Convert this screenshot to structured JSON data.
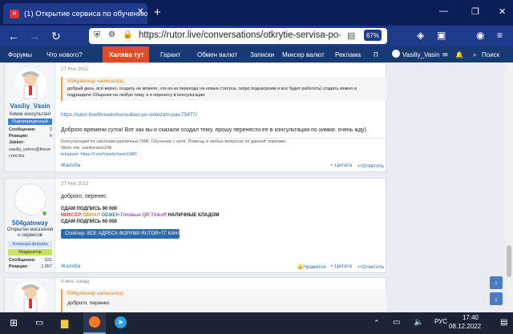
{
  "browser": {
    "tab_title": "(1) Открытие сервиса по обучению",
    "url": "https://rutor.live/conversations/otkrytie-servisa-po-obuchen",
    "zoom": "67%"
  },
  "site_menu": {
    "items": [
      "Форумы",
      "Что нового?",
      "Халява тут",
      "Гарант",
      "Обмен валют",
      "Записки",
      "Миксер валют",
      "Реклама",
      "П"
    ],
    "user": "Vasiliy_Vasin",
    "search": "Поиск"
  },
  "posts": [
    {
      "username": "Vasiliy_Vasin",
      "user_title": "Химик консультант",
      "badge": "Подтвержденный",
      "stats": [
        {
          "label": "Сообщения:",
          "value": "2"
        },
        {
          "label": "Реакции:",
          "value": "6"
        },
        {
          "label": "Jabber:",
          "value": ""
        }
      ],
      "jabber_value": "vasiliy_vetrov@thesecure.biz",
      "date": "27 Ноя 2022",
      "quote_author": "504gateway написал(а):",
      "quote_lines": [
        "добрый день, все верно, создать не можете, это из-за перехода на новые статусы, скоро поднасроим и все будет работать) создать можно в",
        "подразделе Общение на любую тему, а я перенесу в консультации"
      ],
      "link": "https://rutor.live/threads/konsultaci-po-sintezam-pav.75477/",
      "text": "Доброго времени суток! Вот как вы и сказали создал тему. прошу перенести ее в консультации по химии. очень жду)",
      "signature": [
        "Консультации по синтезам различных ПАВ. Обучение с нуля. Помощь в любых вопросах по данной тематике.",
        "Wickr me: vasiliyvasin198",
        "telegram: https://t.me/VasiliyVasin1980"
      ],
      "footer": {
        "report": "Жалоба",
        "quote": "Цитата",
        "reply": "Ответить"
      }
    },
    {
      "username": "504gateway",
      "user_title_lines": [
        "Открытие магазинов",
        "и сервисов"
      ],
      "badges": [
        "Команда форума",
        "Модератор"
      ],
      "stats": [
        {
          "label": "Сообщения:",
          "value": "521"
        },
        {
          "label": "Реакции:",
          "value": "1.057"
        }
      ],
      "date": "27 Ноя 2022",
      "text": "доброго, перенес",
      "ad_lines": [
        "СДАМ ПОДПИСЬ 90 000",
        "МИКСЕР ОБНАЛ ОБМЕН Готовые QR Tinkoff НАЛИЧНЫЕ КЛАДОМ",
        "СДАМ ПОДПИСЬ 60 000"
      ],
      "spoiler": "Спойлер: ВСЕ АДРЕСА ФОРУМА RUTOR+TГ КАНАЛ",
      "footer": {
        "report": "Жалоба",
        "like": "Нравится",
        "quote": "Цитата",
        "reply": "Ответить"
      }
    },
    {
      "date": "4 мин. назад",
      "quote_author": "504gateway написал(а):",
      "text": "доброго, перенес"
    }
  ],
  "taskbar": {
    "lang": "РУС",
    "time": "17:40",
    "date": "08.12.2022"
  }
}
